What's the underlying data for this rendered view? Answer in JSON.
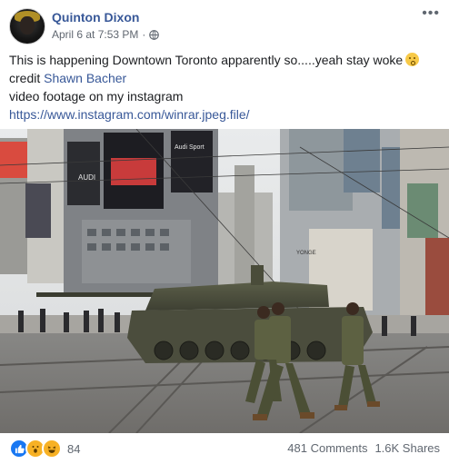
{
  "post": {
    "author": "Quinton Dixon",
    "timestamp": "April 6 at 7:53 PM",
    "separator": "·",
    "privacy_icon": "globe-icon",
    "more_icon": "ellipsis-icon",
    "more_label": "•••",
    "line1": "This is happening Downtown Toronto apparently so.....yeah stay woke",
    "line1_emoji": "confused-face-emoji",
    "credit_prefix": "credit ",
    "credit_name": "Shawn Bacher",
    "line3": "video footage on my instagram",
    "link": "https://www.instagram.com/winrar.jpeg.file/"
  },
  "photo": {
    "billboard_brand_1": "AUDI",
    "billboard_brand_2": "Audi Sport",
    "street_sign": "YONGE"
  },
  "footer": {
    "reaction_icons": [
      "like-icon",
      "wow-icon",
      "haha-icon"
    ],
    "reaction_count": "84",
    "comments": "481 Comments",
    "shares": "1.6K Shares"
  },
  "colors": {
    "link": "#385898",
    "secondary_text": "#606770",
    "like_blue": "#1877f2",
    "emoji_yellow": "#f7b125"
  }
}
